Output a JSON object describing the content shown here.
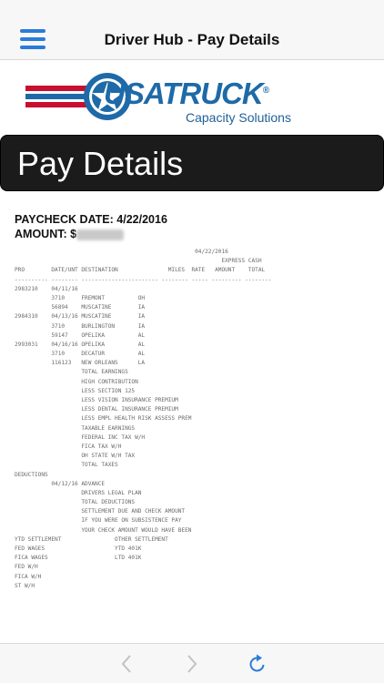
{
  "nav": {
    "title": "Driver Hub - Pay Details",
    "menu_icon": "hamburger-menu-icon"
  },
  "logo": {
    "brand": "USATRUCK",
    "registered": "®",
    "tagline": "Capacity Solutions"
  },
  "banner": {
    "title": "Pay Details"
  },
  "paycheck": {
    "date_label": "PAYCHECK DATE: 4/22/2016",
    "amount_label": "AMOUNT: $"
  },
  "stub_lines": [
    "                                                      04/22/2016",
    "                                                              EXPRESS CASH",
    "PRO        DATE/UNT DESTINATION               MILES  RATE   AMOUNT    TOTAL",
    "---------- -------- ----------------------- -------- ----- --------- --------",
    "2983210    04/11/16",
    "           3710     FREMONT          OH",
    "           56894    MUSCATINE        IA",
    "2984310    04/13/16 MUSCATINE        IA",
    "           3710     BURLINGTON       IA",
    "           59147    OPELIKA          AL",
    "2993031    04/16/16 OPELIKA          AL",
    "           3710     DECATUR          AL",
    "           116123   NEW ORLEANS      LA",
    "                    TOTAL EARNINGS",
    "                    HIGH CONTRIBUTION",
    "                    LESS SECTION 125",
    "                    LESS VISION INSURANCE PREMIUM",
    "                    LESS DENTAL INSURANCE PREMIUM",
    "                    LESS EMPL HEALTH RISK ASSESS PREM",
    "                    TAXABLE EARNINGS",
    "                    FEDERAL INC TAX W/H",
    "                    FICA TAX W/H",
    "                    OH STATE W/H TAX",
    "                    TOTAL TAXES",
    "DEDUCTIONS",
    "           04/12/16 ADVANCE",
    "                    DRIVERS LEGAL PLAN",
    "                    TOTAL DEDUCTIONS",
    "                    SETTLEMENT DUE AND CHECK AMOUNT",
    "                    IF YOU WERE ON SUBSISTENCE PAY",
    "                    YOUR CHECK AMOUNT WOULD HAVE BEEN",
    "YTD SETTLEMENT                OTHER SETTLEMENT",
    "FED WAGES                     YTD 401K",
    "FICA WAGES                    LTD 401K",
    "FED W/H",
    "FICA W/H",
    "ST W/H"
  ],
  "toolbar": {
    "back_icon": "chevron-left-icon",
    "forward_icon": "chevron-right-icon",
    "reload_icon": "reload-icon"
  }
}
